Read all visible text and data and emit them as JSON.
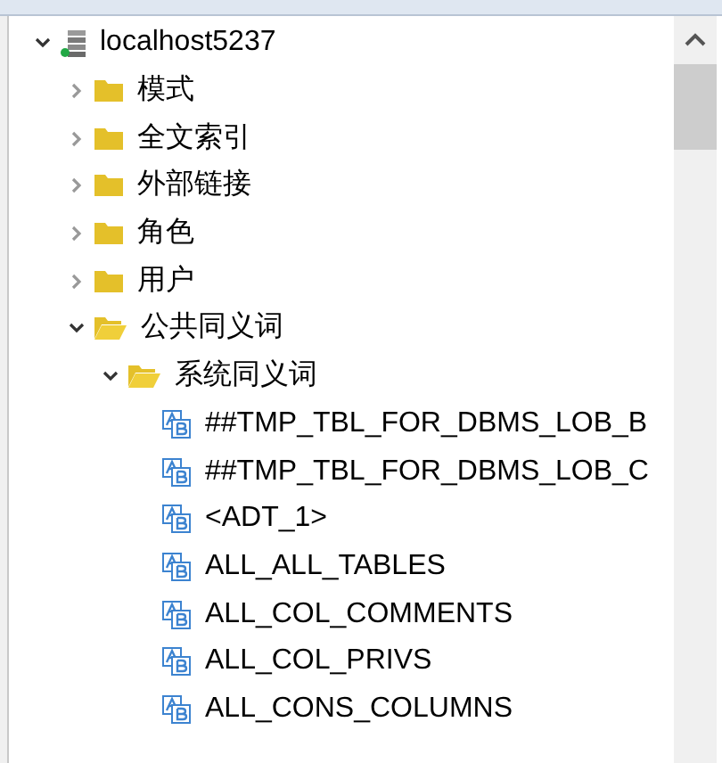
{
  "tree": [
    {
      "label": "localhost5237",
      "kind": "server",
      "expanded": true,
      "children": [
        {
          "label": "模式",
          "kind": "folder",
          "expanded": false
        },
        {
          "label": "全文索引",
          "kind": "folder",
          "expanded": false
        },
        {
          "label": "外部链接",
          "kind": "folder",
          "expanded": false
        },
        {
          "label": "角色",
          "kind": "folder",
          "expanded": false
        },
        {
          "label": "用户",
          "kind": "folder",
          "expanded": false
        },
        {
          "label": "公共同义词",
          "kind": "folder",
          "expanded": true,
          "children": [
            {
              "label": "系统同义词",
              "kind": "folder",
              "expanded": true,
              "children": [
                {
                  "label": "##TMP_TBL_FOR_DBMS_LOB_B",
                  "kind": "synonym"
                },
                {
                  "label": "##TMP_TBL_FOR_DBMS_LOB_C",
                  "kind": "synonym"
                },
                {
                  "label": "<ADT_1>",
                  "kind": "synonym"
                },
                {
                  "label": "ALL_ALL_TABLES",
                  "kind": "synonym"
                },
                {
                  "label": "ALL_COL_COMMENTS",
                  "kind": "synonym"
                },
                {
                  "label": "ALL_COL_PRIVS",
                  "kind": "synonym"
                },
                {
                  "label": "ALL_CONS_COLUMNS",
                  "kind": "synonym"
                }
              ]
            }
          ]
        }
      ]
    }
  ]
}
